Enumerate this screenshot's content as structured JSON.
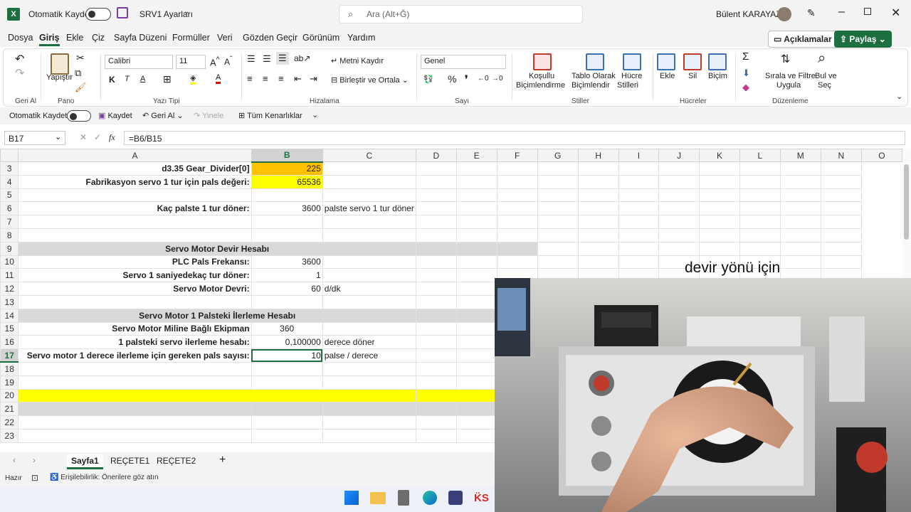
{
  "titlebar": {
    "autosave": "Otomatik Kaydet",
    "filename": "SRV1 Ayarları",
    "search_placeholder": "Ara (Alt+Ğ)",
    "user": "Bülent KARAYAZI"
  },
  "menu": [
    "Dosya",
    "Giriş",
    "Ekle",
    "Çiz",
    "Sayfa Düzeni",
    "Formüller",
    "Veri",
    "Gözden Geçir",
    "Görünüm",
    "Yardım"
  ],
  "menu_right": {
    "comments": "Açıklamalar",
    "share": "Paylaş"
  },
  "ribbon": {
    "groups": {
      "undo": "Geri Al",
      "clipboard": "Pano",
      "font": "Yazı Tipi",
      "alignment": "Hizalama",
      "number": "Sayı",
      "styles": "Stiller",
      "cells": "Hücreler",
      "editing": "Düzenleme"
    },
    "paste": "Yapıştır",
    "font_name": "Calibri",
    "font_size": "11",
    "wrap_text": "Metni Kaydır",
    "merge_center": "Birleştir ve Ortala",
    "number_format": "Genel",
    "cond_format_1": "Koşullu",
    "cond_format_2": "Biçimlendirme",
    "table_format_1": "Tablo Olarak",
    "table_format_2": "Biçimlendir",
    "cell_styles_1": "Hücre",
    "cell_styles_2": "Stilleri",
    "insert": "Ekle",
    "delete": "Sil",
    "format": "Biçim",
    "sort_1": "Sırala ve Filtre",
    "sort_2": "Uygula",
    "find_1": "Bul ve",
    "find_2": "Seç"
  },
  "qat": {
    "autosave": "Otomatik Kaydet",
    "save": "Kaydet",
    "undo": "Geri Al",
    "redo": "Yinele",
    "borders": "Tüm Kenarlıklar"
  },
  "formula_bar": {
    "name_box": "B17",
    "formula": "=B6/B15"
  },
  "columns": [
    "A",
    "B",
    "C",
    "D",
    "E",
    "F",
    "G",
    "H",
    "I",
    "J",
    "K",
    "L",
    "M",
    "N",
    "O"
  ],
  "rows": [
    {
      "n": "3",
      "a": "d3.35 Gear_Divider[0]",
      "b": "225",
      "c": "",
      "style": "orange"
    },
    {
      "n": "4",
      "a": "Fabrikasyon servo 1 tur için pals değeri:",
      "b": "65536",
      "c": "",
      "style": "yellow"
    },
    {
      "n": "5",
      "a": "",
      "b": "",
      "c": ""
    },
    {
      "n": "6",
      "a": "Kaç palste 1 tur döner:",
      "b": "3600",
      "c": "palste servo 1 tur döner"
    },
    {
      "n": "7",
      "a": "",
      "b": "",
      "c": ""
    },
    {
      "n": "8",
      "a": "",
      "b": "",
      "c": ""
    },
    {
      "n": "9",
      "a": "Servo Motor Devir Hesabı",
      "b": "",
      "c": "",
      "style": "header"
    },
    {
      "n": "10",
      "a": "PLC Pals Frekansı:",
      "b": "3600",
      "c": ""
    },
    {
      "n": "11",
      "a": "Servo 1 saniyedekaç tur döner:",
      "b": "1",
      "c": ""
    },
    {
      "n": "12",
      "a": "Servo Motor Devri:",
      "b": "60",
      "c": "d/dk"
    },
    {
      "n": "13",
      "a": "",
      "b": "",
      "c": ""
    },
    {
      "n": "14",
      "a": "Servo Motor 1 Palsteki İlerleme Hesabı",
      "b": "",
      "c": "",
      "style": "header"
    },
    {
      "n": "15",
      "a": "Servo Motor Miline Bağlı Ekipman",
      "b": "360",
      "c": "",
      "bcenter": true
    },
    {
      "n": "16",
      "a": "1 palsteki servo ilerleme hesabı:",
      "b": "0,100000",
      "c": "derece döner"
    },
    {
      "n": "17",
      "a": "Servo motor 1 derece ilerleme için gereken pals sayısı:",
      "b": "10",
      "c": "palse / derece",
      "selected": true
    },
    {
      "n": "18",
      "a": "",
      "b": "",
      "c": ""
    },
    {
      "n": "19",
      "a": "",
      "b": "",
      "c": ""
    },
    {
      "n": "20",
      "a": "",
      "b": "",
      "c": "",
      "style": "yellowband"
    },
    {
      "n": "21",
      "a": "",
      "b": "",
      "c": "",
      "style": "grayband"
    },
    {
      "n": "22",
      "a": "",
      "b": "",
      "c": ""
    },
    {
      "n": "23",
      "a": "",
      "b": "",
      "c": ""
    }
  ],
  "sheets": [
    "Sayfa1",
    "REÇETE1",
    "REÇETE2"
  ],
  "status": {
    "ready": "Hazır",
    "accessibility": "Erişilebilirlik: Önerilere göz atın"
  },
  "video": {
    "caption": "devir yönü için"
  },
  "colors": {
    "accent": "#1d6f42",
    "yellow": "#ffff00",
    "orange": "#ffc000"
  }
}
